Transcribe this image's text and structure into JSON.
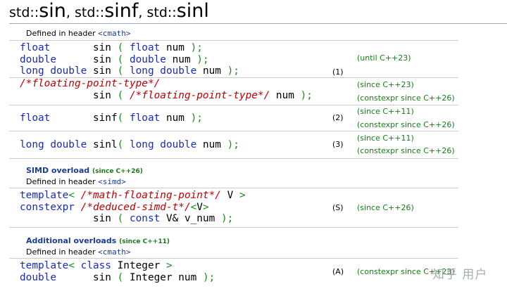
{
  "title": {
    "prefix1": "std::",
    "name1": "sin",
    "sep1": ", ",
    "prefix2": "std::",
    "name2": "sinf",
    "sep2": ", ",
    "prefix3": "std::",
    "name3": "sinl"
  },
  "header1": {
    "label": "Defined in header ",
    "name": "<cmath>"
  },
  "overload1": {
    "lines": [
      [
        [
          "kw",
          "float"
        ],
        [
          "tx",
          "       sin "
        ],
        [
          "pn",
          "("
        ],
        [
          "tx",
          " "
        ],
        [
          "kw",
          "float"
        ],
        [
          "tx",
          " num "
        ],
        [
          "pn",
          ");"
        ]
      ],
      [
        [
          "kw",
          "double"
        ],
        [
          "tx",
          "      sin "
        ],
        [
          "pn",
          "("
        ],
        [
          "tx",
          " "
        ],
        [
          "kw",
          "double"
        ],
        [
          "tx",
          " num "
        ],
        [
          "pn",
          ");"
        ]
      ],
      [
        [
          "kw",
          "long double"
        ],
        [
          "tx",
          " sin "
        ],
        [
          "pn",
          "("
        ],
        [
          "tx",
          " "
        ],
        [
          "kw",
          "long double"
        ],
        [
          "tx",
          " num "
        ],
        [
          "pn",
          ");"
        ]
      ]
    ],
    "since": "(until C++23)",
    "num": "(1)"
  },
  "overload1b": {
    "lines": [
      [
        [
          "cm",
          "/*floating-point-type*/"
        ]
      ],
      [
        [
          "tx",
          "            sin "
        ],
        [
          "pn",
          "("
        ],
        [
          "tx",
          " "
        ],
        [
          "cm",
          "/*floating-point-type*/"
        ],
        [
          "tx",
          " num "
        ],
        [
          "pn",
          ");"
        ]
      ]
    ],
    "since1": "(since C++23)",
    "since2": "(constexpr since C++26)"
  },
  "overload2": {
    "lines": [
      [
        [
          "kw",
          "float"
        ],
        [
          "tx",
          "       sinf"
        ],
        [
          "pn",
          "("
        ],
        [
          "tx",
          " "
        ],
        [
          "kw",
          "float"
        ],
        [
          "tx",
          " num "
        ],
        [
          "pn",
          ");"
        ]
      ]
    ],
    "num": "(2)",
    "since1": "(since C++11)",
    "since2": "(constexpr since C++26)"
  },
  "overload3": {
    "lines": [
      [
        [
          "kw",
          "long double"
        ],
        [
          "tx",
          " sinl"
        ],
        [
          "pn",
          "("
        ],
        [
          "tx",
          " "
        ],
        [
          "kw",
          "long double"
        ],
        [
          "tx",
          " num "
        ],
        [
          "pn",
          ");"
        ]
      ]
    ],
    "num": "(3)",
    "since1": "(since C++11)",
    "since2": "(constexpr since C++26)"
  },
  "simd_section": {
    "title": "SIMD overload",
    "since": "(since C++26)"
  },
  "header2": {
    "label": "Defined in header ",
    "name": "<simd>"
  },
  "overloadS": {
    "lines": [
      [
        [
          "kw",
          "template"
        ],
        [
          "pn",
          "<"
        ],
        [
          "tx",
          " "
        ],
        [
          "cm",
          "/*math-floating-point*/"
        ],
        [
          "tx",
          " V "
        ],
        [
          "pn",
          ">"
        ]
      ],
      [
        [
          "kw",
          "constexpr"
        ],
        [
          "tx",
          " "
        ],
        [
          "cm",
          "/*deduced-simd-t*/"
        ],
        [
          "pn",
          "<"
        ],
        [
          "tx",
          "V"
        ],
        [
          "pn",
          ">"
        ]
      ],
      [
        [
          "tx",
          "            sin "
        ],
        [
          "pn",
          "("
        ],
        [
          "tx",
          " "
        ],
        [
          "kw",
          "const"
        ],
        [
          "tx",
          " V& v_num "
        ],
        [
          "pn",
          ");"
        ]
      ]
    ],
    "num": "(S)",
    "since": "(since C++26)"
  },
  "additional_section": {
    "title": "Additional overloads",
    "since": "(since C++11)"
  },
  "header3": {
    "label": "Defined in header ",
    "name": "<cmath>"
  },
  "overloadA": {
    "lines": [
      [
        [
          "kw",
          "template"
        ],
        [
          "pn",
          "<"
        ],
        [
          "tx",
          " "
        ],
        [
          "kw",
          "class"
        ],
        [
          "tx",
          " Integer "
        ],
        [
          "pn",
          ">"
        ]
      ],
      [
        [
          "kw",
          "double"
        ],
        [
          "tx",
          "      sin "
        ],
        [
          "pn",
          "("
        ],
        [
          "tx",
          " Integer num "
        ],
        [
          "pn",
          ");"
        ]
      ]
    ],
    "num": "(A)",
    "since": "(constexpr since C++23)"
  },
  "watermark": "知乎 用户"
}
